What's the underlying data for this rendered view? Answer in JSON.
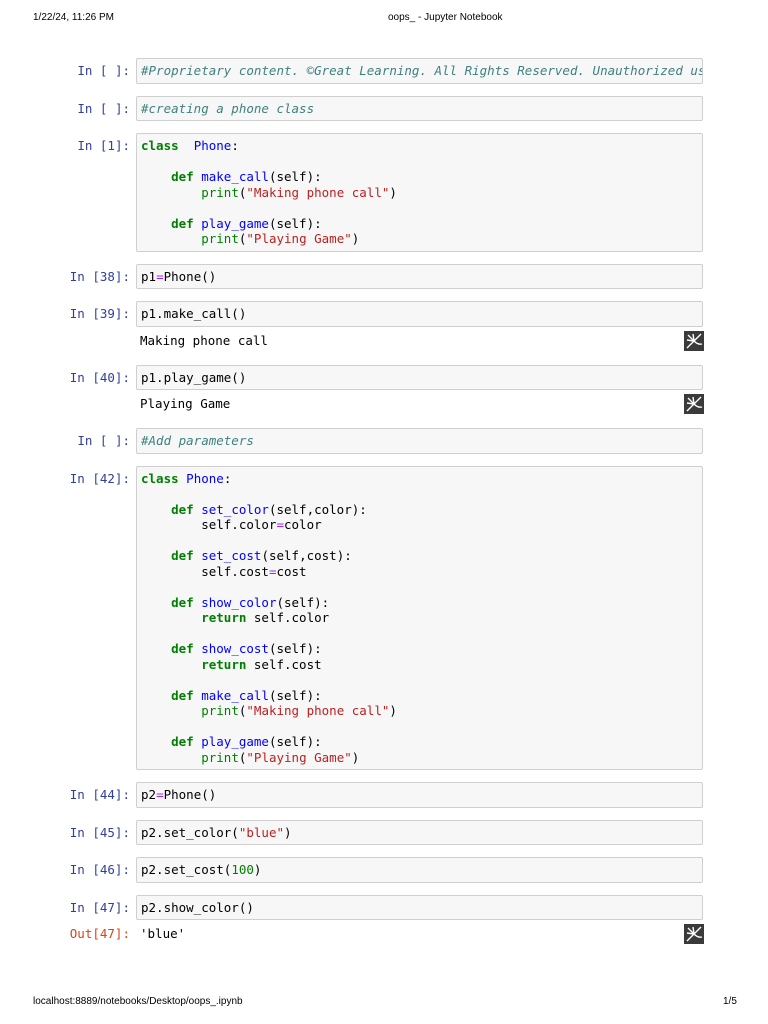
{
  "header": {
    "datetime": "1/22/24, 11:26 PM",
    "title": "oops_ - Jupyter Notebook"
  },
  "footer": {
    "url": "localhost:8889/notebooks/Desktop/oops_.ipynb",
    "page": "1/5"
  },
  "output_icon": "trusted-image-icon",
  "cells": [
    {
      "prompt": "In [ ]:",
      "lines": [
        [
          [
            "c",
            "#Proprietary content. ©Great Learning. All Rights Reserved. Unauthorized use or distribution prohibited."
          ]
        ]
      ]
    },
    {
      "prompt": "In [ ]:",
      "lines": [
        [
          [
            "c",
            "#creating a phone class"
          ]
        ]
      ]
    },
    {
      "prompt": "In [1]:",
      "lines": [
        [
          [
            "k",
            "class"
          ],
          [
            "",
            "  "
          ],
          [
            "nc",
            "Phone"
          ],
          [
            "",
            ":"
          ]
        ],
        [],
        [
          [
            "",
            "    "
          ],
          [
            "k",
            "def"
          ],
          [
            "",
            " "
          ],
          [
            "nf",
            "make_call"
          ],
          [
            "",
            "(self):"
          ]
        ],
        [
          [
            "",
            "        "
          ],
          [
            "bi",
            "print"
          ],
          [
            "",
            "("
          ],
          [
            "s",
            "\"Making phone call\""
          ],
          [
            "",
            ")"
          ]
        ],
        [],
        [
          [
            "",
            "    "
          ],
          [
            "k",
            "def"
          ],
          [
            "",
            " "
          ],
          [
            "nf",
            "play_game"
          ],
          [
            "",
            "(self):"
          ]
        ],
        [
          [
            "",
            "        "
          ],
          [
            "bi",
            "print"
          ],
          [
            "",
            "("
          ],
          [
            "s",
            "\"Playing Game\""
          ],
          [
            "",
            ")"
          ]
        ]
      ]
    },
    {
      "prompt": "In [38]:",
      "lines": [
        [
          [
            "",
            "p1"
          ],
          [
            "o",
            "="
          ],
          [
            "",
            "Phone()"
          ]
        ]
      ]
    },
    {
      "prompt": "In [39]:",
      "lines": [
        [
          [
            "",
            "p1.make_call()"
          ]
        ]
      ],
      "output": {
        "prompt": "",
        "text": "Making phone call"
      }
    },
    {
      "prompt": "In [40]:",
      "lines": [
        [
          [
            "",
            "p1.play_game()"
          ]
        ]
      ],
      "output": {
        "prompt": "",
        "text": "Playing Game"
      }
    },
    {
      "prompt": "In [ ]:",
      "lines": [
        [
          [
            "c",
            "#Add parameters"
          ]
        ]
      ]
    },
    {
      "prompt": "In [42]:",
      "lines": [
        [
          [
            "k",
            "class"
          ],
          [
            "",
            " "
          ],
          [
            "nc",
            "Phone"
          ],
          [
            "",
            ":"
          ]
        ],
        [],
        [
          [
            "",
            "    "
          ],
          [
            "k",
            "def"
          ],
          [
            "",
            " "
          ],
          [
            "nf",
            "set_color"
          ],
          [
            "",
            "(self,color):"
          ]
        ],
        [
          [
            "",
            "        self.color"
          ],
          [
            "o",
            "="
          ],
          [
            "",
            "color"
          ]
        ],
        [],
        [
          [
            "",
            "    "
          ],
          [
            "k",
            "def"
          ],
          [
            "",
            " "
          ],
          [
            "nf",
            "set_cost"
          ],
          [
            "",
            "(self,cost):"
          ]
        ],
        [
          [
            "",
            "        self.cost"
          ],
          [
            "o",
            "="
          ],
          [
            "",
            "cost"
          ]
        ],
        [],
        [
          [
            "",
            "    "
          ],
          [
            "k",
            "def"
          ],
          [
            "",
            " "
          ],
          [
            "nf",
            "show_color"
          ],
          [
            "",
            "(self):"
          ]
        ],
        [
          [
            "",
            "        "
          ],
          [
            "k",
            "return"
          ],
          [
            "",
            " self.color"
          ]
        ],
        [],
        [
          [
            "",
            "    "
          ],
          [
            "k",
            "def"
          ],
          [
            "",
            " "
          ],
          [
            "nf",
            "show_cost"
          ],
          [
            "",
            "(self):"
          ]
        ],
        [
          [
            "",
            "        "
          ],
          [
            "k",
            "return"
          ],
          [
            "",
            " self.cost"
          ]
        ],
        [],
        [
          [
            "",
            "    "
          ],
          [
            "k",
            "def"
          ],
          [
            "",
            " "
          ],
          [
            "nf",
            "make_call"
          ],
          [
            "",
            "(self):"
          ]
        ],
        [
          [
            "",
            "        "
          ],
          [
            "bi",
            "print"
          ],
          [
            "",
            "("
          ],
          [
            "s",
            "\"Making phone call\""
          ],
          [
            "",
            ")"
          ]
        ],
        [],
        [
          [
            "",
            "    "
          ],
          [
            "k",
            "def"
          ],
          [
            "",
            " "
          ],
          [
            "nf",
            "play_game"
          ],
          [
            "",
            "(self):"
          ]
        ],
        [
          [
            "",
            "        "
          ],
          [
            "bi",
            "print"
          ],
          [
            "",
            "("
          ],
          [
            "s",
            "\"Playing Game\""
          ],
          [
            "",
            ")"
          ]
        ]
      ]
    },
    {
      "prompt": "In [44]:",
      "lines": [
        [
          [
            "",
            "p2"
          ],
          [
            "o",
            "="
          ],
          [
            "",
            "Phone()"
          ]
        ]
      ]
    },
    {
      "prompt": "In [45]:",
      "lines": [
        [
          [
            "",
            "p2.set_color("
          ],
          [
            "s",
            "\"blue\""
          ],
          [
            "",
            ")"
          ]
        ]
      ]
    },
    {
      "prompt": "In [46]:",
      "lines": [
        [
          [
            "",
            "p2.set_cost("
          ],
          [
            "m",
            "100"
          ],
          [
            "",
            ")"
          ]
        ]
      ]
    },
    {
      "prompt": "In [47]:",
      "lines": [
        [
          [
            "",
            "p2.show_color()"
          ]
        ]
      ],
      "output": {
        "prompt": "Out[47]:",
        "text": "'blue'"
      }
    }
  ]
}
